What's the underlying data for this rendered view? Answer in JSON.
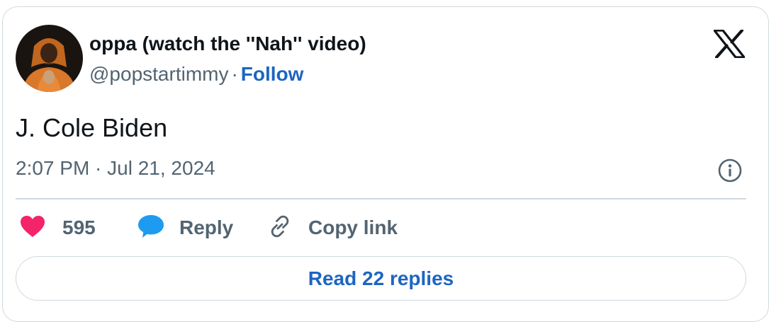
{
  "tweet": {
    "author_name": "oppa (watch the ''Nah'' video)",
    "handle": "@popstartimmy",
    "separator": "·",
    "follow_label": "Follow",
    "text": "J. Cole Biden",
    "timestamp": "2:07 PM · Jul 21, 2024"
  },
  "actions": {
    "like_count": "595",
    "reply_label": "Reply",
    "copy_link_label": "Copy link"
  },
  "read_replies_label": "Read 22 replies",
  "icons": {
    "platform_logo": "x-logo-icon",
    "info": "info-icon",
    "like": "heart-icon",
    "reply": "speech-bubble-icon",
    "copy_link": "link-icon"
  },
  "colors": {
    "accent_link": "#1d65c1",
    "heart": "#f4246c",
    "reply_bubble": "#1d9bf0",
    "muted_text": "#536471",
    "border": "#cfd9de"
  }
}
